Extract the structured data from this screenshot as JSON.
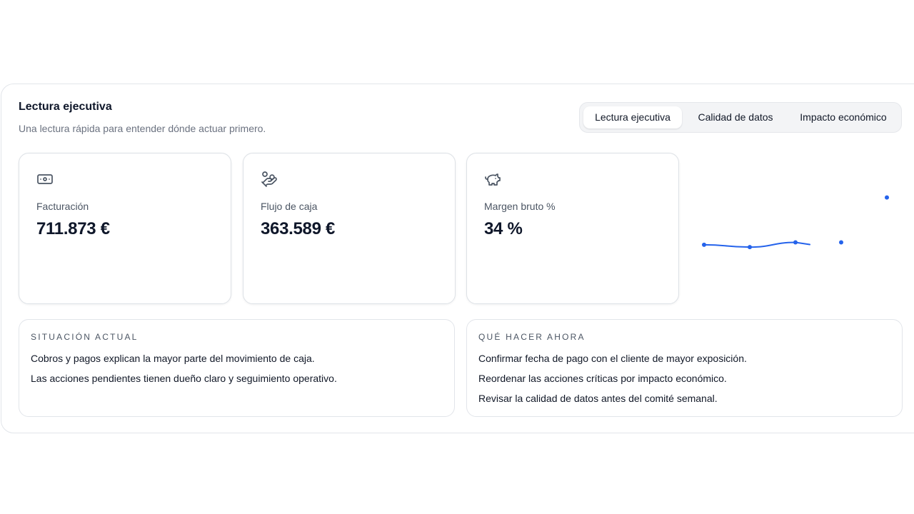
{
  "panel": {
    "title": "Lectura ejecutiva",
    "subtitle": "Una lectura rápida para entender dónde actuar primero."
  },
  "tabs": [
    {
      "label": "Lectura ejecutiva",
      "active": true
    },
    {
      "label": "Calidad de datos",
      "active": false
    },
    {
      "label": "Impacto económico",
      "active": false
    }
  ],
  "kpis": [
    {
      "icon": "banknote-icon",
      "label": "Facturación",
      "value": "711.873 €"
    },
    {
      "icon": "hand-coins-icon",
      "label": "Flujo de caja",
      "value": "363.589 €"
    },
    {
      "icon": "piggy-bank-icon",
      "label": "Margen bruto %",
      "value": "34 %"
    }
  ],
  "notes": {
    "current": {
      "heading": "SITUACIÓN ACTUAL",
      "items": [
        "Cobros y pagos explican la mayor parte del movimiento de caja.",
        "Las acciones pendientes tienen dueño claro y seguimiento operativo."
      ]
    },
    "actions": {
      "heading": "QUÉ HACER AHORA",
      "items": [
        "Confirmar fecha de pago con el cliente de mayor exposición.",
        "Reordenar las acciones críticas por impacto económico.",
        "Revisar la calidad de datos antes del comité semanal."
      ]
    }
  },
  "colors": {
    "accent": "#2563eb",
    "text": "#0f172a",
    "muted": "#6b7280",
    "border": "#e2e5ea"
  },
  "chart_data": {
    "type": "line",
    "x": [
      1,
      2,
      3,
      4,
      5
    ],
    "series": [
      {
        "values": [
          100,
          99,
          101,
          101,
          120
        ]
      }
    ],
    "line_drawn_through_index": 2,
    "grid": false
  }
}
